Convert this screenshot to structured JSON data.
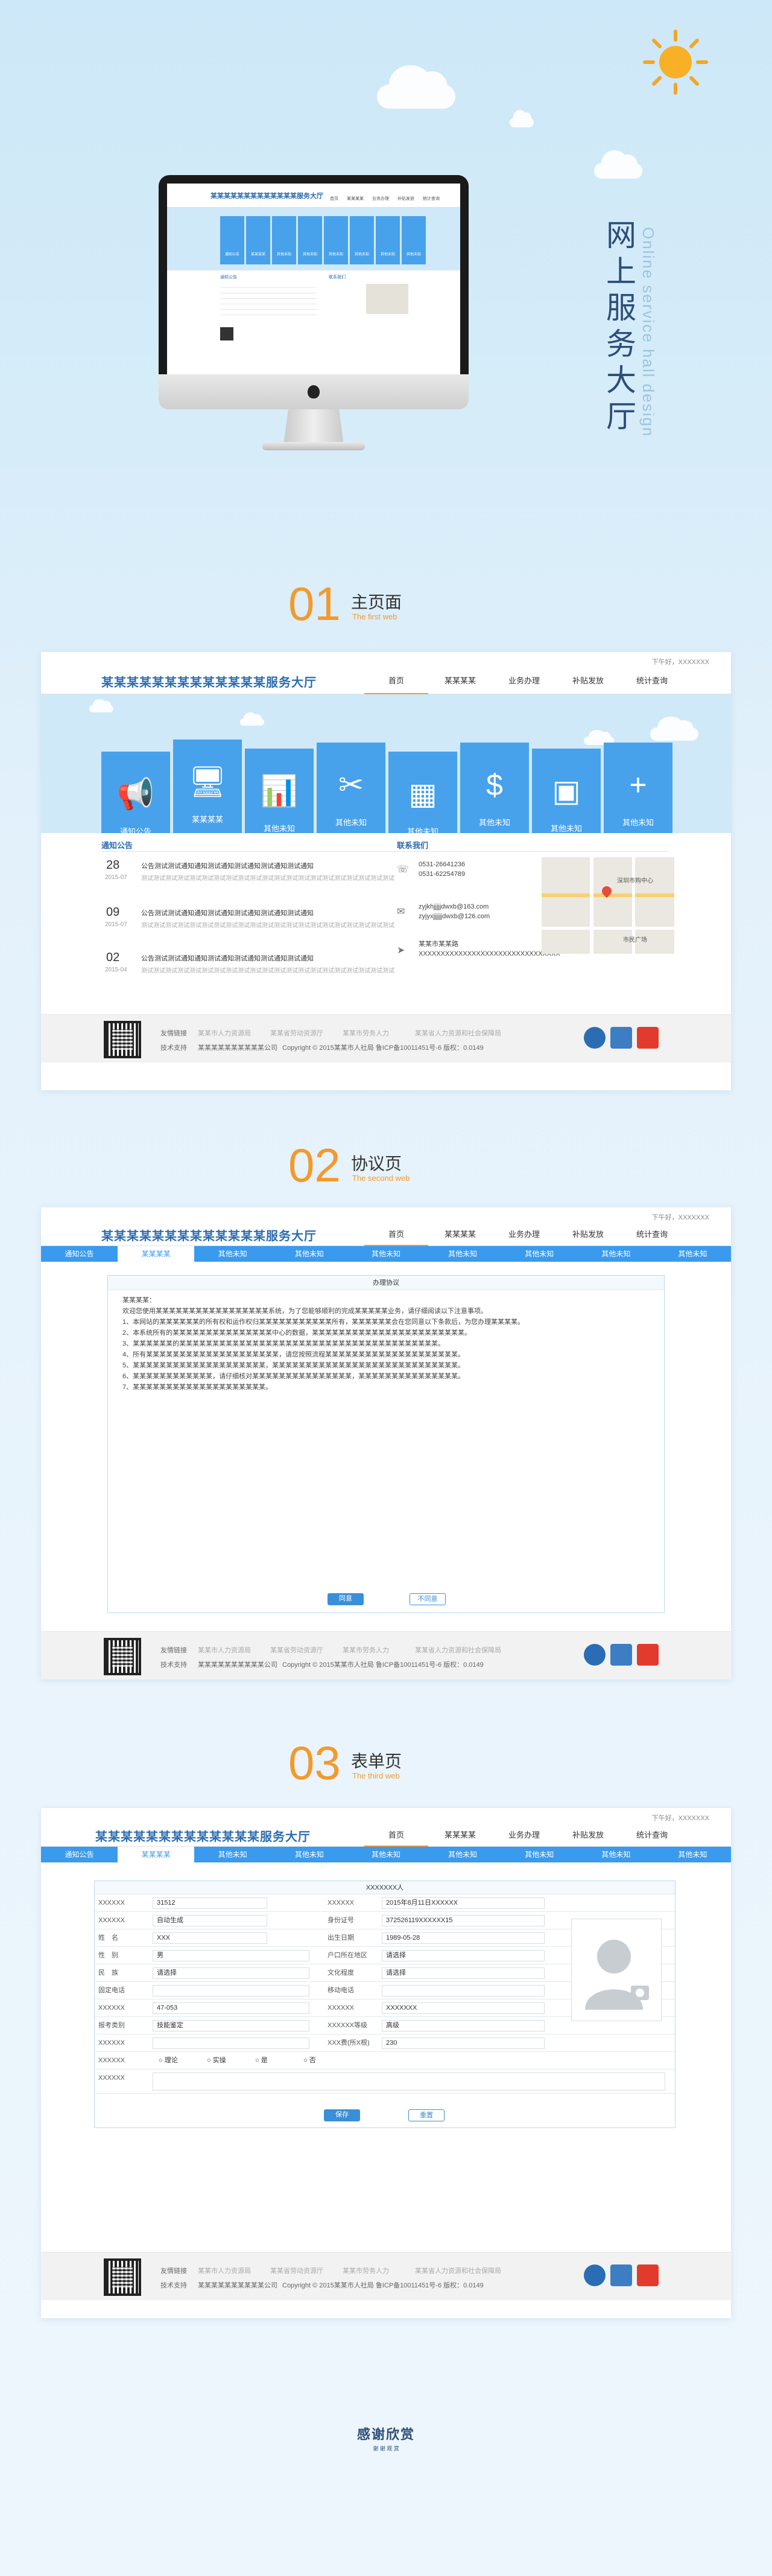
{
  "hero": {
    "title": "网上服务大厅",
    "subtitle": "Online service hall design"
  },
  "mini": {
    "brand": "某某某某某某某某某某某某某服务大厅",
    "nav": [
      "首页",
      "某某某某",
      "业务办理",
      "补贴发放",
      "统计查询"
    ],
    "tiles": [
      "通知公告",
      "某某某某",
      "其他未知",
      "其他未知",
      "其他未知",
      "其他未知",
      "其他未知",
      "其他未知"
    ],
    "notice_title": "通知公告",
    "contact_title": "联系我们"
  },
  "sections": [
    {
      "num": "01",
      "title": "主页面",
      "sub": "The first web"
    },
    {
      "num": "02",
      "title": "协议页",
      "sub": "The second web"
    },
    {
      "num": "03",
      "title": "表单页",
      "sub": "The third web"
    }
  ],
  "common": {
    "topline": "下午好，XXXXXXX",
    "brand": "某某某某某某某某某某某某某服务大厅",
    "nav": [
      "首页",
      "某某某某",
      "业务办理",
      "补贴发放",
      "统计查询"
    ],
    "footer": {
      "link_label": "友情链接",
      "links": [
        "某某市人力资源局",
        "某某省劳动资源厅",
        "某某市劳务人力",
        "某某省人力资源和社会保障局"
      ],
      "support_label": "技术支持",
      "support": "某某某某某某某某某某公司",
      "copyright": "Copyright © 2015某某市人社局 鲁ICP备10011451号-6 版权：0.0149"
    }
  },
  "home": {
    "tiles": [
      {
        "label": "通知公告",
        "icon": "megaphone-icon",
        "glyph": "📢"
      },
      {
        "label": "某某某某",
        "icon": "monitor-icon",
        "glyph": "🖥"
      },
      {
        "label": "其他未知",
        "icon": "bar-chart-icon",
        "glyph": "📊"
      },
      {
        "label": "其他未知",
        "icon": "tools-icon",
        "glyph": "✂"
      },
      {
        "label": "其他未知",
        "icon": "document-icon",
        "glyph": "▦"
      },
      {
        "label": "其他未知",
        "icon": "money-bag-icon",
        "glyph": "$"
      },
      {
        "label": "其他未知",
        "icon": "id-card-icon",
        "glyph": "▣"
      },
      {
        "label": "其他未知",
        "icon": "plus-icon",
        "glyph": "+"
      }
    ],
    "notice": {
      "title": "通知公告",
      "items": [
        {
          "day": "28",
          "ym": "2015-07",
          "title": "公告测试测试通知通知测试通知测试通知测试通知测试通知",
          "desc": "测试测试测试测试测试测试测试测试测试测试测试测试测试测试测试测试测试测试测试测试测试"
        },
        {
          "day": "09",
          "ym": "2015-07",
          "title": "公告测试测试通知通知测试通知测试通知测试通知测试通知",
          "desc": "测试测试测试测试测试测试测试测试测试测试测试测试测试测试测试测试测试测试测试测试测试"
        },
        {
          "day": "02",
          "ym": "2015-04",
          "title": "公告测试测试通知通知测试通知测试通知测试通知测试通知",
          "desc": "测试测试测试测试测试测试测试测试测试测试测试测试测试测试测试测试测试测试测试测试测试"
        }
      ]
    },
    "contact": {
      "title": "联系我们",
      "phone1": "0531-26641236",
      "phone2": "0531-62254789",
      "email1": "zyjkhjjjjjdwxb@163.com",
      "email2": "zyjyxjjjjjjdwxb@126.com",
      "address": "某某市某某路XXXXXXXXXXXXXXXXXXXXXXXXXXXXXXXX"
    },
    "map_labels": [
      "深圳市购中心",
      "市民广场"
    ]
  },
  "agreement": {
    "subnav": [
      "通知公告",
      "某某某某",
      "其他未知",
      "其他未知",
      "其他未知",
      "其他未知",
      "其他未知",
      "其他未知",
      "其他未知"
    ],
    "panel_title": "办理协议",
    "greeting": "某某某某：",
    "intro": "欢迎您使用某某某某某某某某某某某某某某某某某系统，为了您能够顺利的完成某某某某某业务，请仔细阅读以下注意事项。",
    "items": [
      "1、本网站的某某某某某某的所有权和运作权归某某某某某某某某某某某所有，某某某某某某会在您同意以下条款后，为您办理某某某某。",
      "2、本系统所有的某某某某某某某某某某某某某某某中心的数据，某某某某某某某某某某某某某某某某某某某某某某某。",
      "3、某某某某某某的某某某某某某某某某某某某某某某某某某某某某某某某某某某某某某某某某某某某某某某。",
      "4、所有某某某某某某某某某某某某某某某某某某某某，请您按照流程某某某某某某某某某某某某某某某某某某某某。",
      "5、某某某某某某某某某某某某某某某某某某某某，某某某某某某某某某某某某某某某某某某某某某某某某某某某某。",
      "6、某某某某某某某某某某某某，请仔细核对某某某某某某某某某某某某某某某，某某某某某某某某某某某某某某某。",
      "7、某某某某某某某某某某某某某某某某某某某某。"
    ],
    "agree": "同意",
    "disagree": "不同意"
  },
  "form": {
    "subnav": [
      "通知公告",
      "某某某某",
      "其他未知",
      "其他未知",
      "其他未知",
      "其他未知",
      "其他未知",
      "其他未知",
      "其他未知"
    ],
    "title": "XXXXXXX人",
    "rows": [
      {
        "l1": "XXXXXX",
        "v1": "31512",
        "l2": "XXXXXX",
        "v2": "2015年8月11日XXXXXX"
      },
      {
        "l1": "XXXXXX",
        "v1": "自动生成",
        "l2": "身份证号",
        "v2": "372526119XXXXXX15"
      },
      {
        "l1": "姓　名",
        "v1": "XXX",
        "l2": "出生日期",
        "v2": "1989-05-28"
      },
      {
        "l1": "性　别",
        "v1": "男",
        "l2": "户口所在地区",
        "v2": "请选择"
      },
      {
        "l1": "民　族",
        "v1": "请选择",
        "l2": "文化程度",
        "v2": "请选择"
      },
      {
        "l1": "固定电话",
        "v1": "",
        "l2": "移动电话",
        "v2": ""
      },
      {
        "l1": "XXXXXX",
        "v1": "47-053",
        "l2": "XXXXXX",
        "v2": "XXXXXXX"
      },
      {
        "l1": "报考类别",
        "v1": "技能鉴定",
        "l2": "XXXXXX等级",
        "v2": "高级"
      },
      {
        "l1": "XXXXXX",
        "v1": "",
        "l2": "XXX费(所X根)",
        "v2": "230"
      }
    ],
    "radio_label": "XXXXXX",
    "radios": [
      "理论",
      "实操",
      "是",
      "否"
    ],
    "last_label": "XXXXXX",
    "save": "保存",
    "reset": "重置"
  },
  "thanks": {
    "title": "感谢欣赏",
    "sub": "谢 谢 观 赏"
  }
}
